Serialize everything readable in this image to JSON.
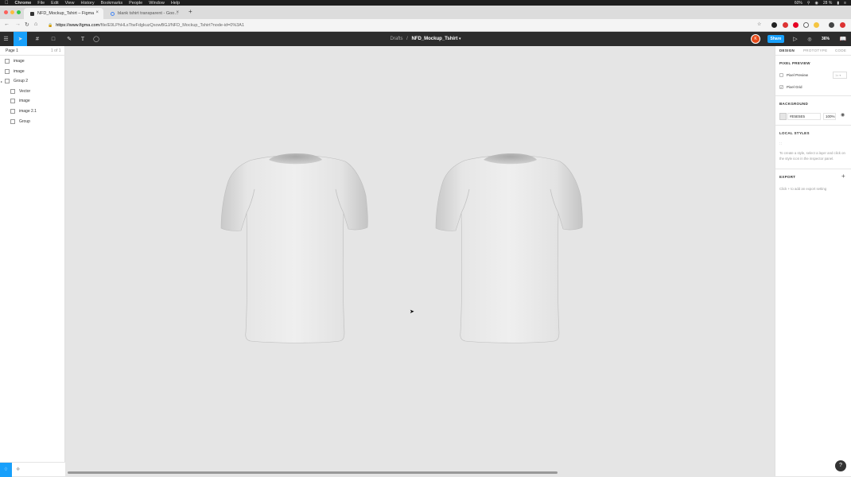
{
  "menubar": {
    "app": "Chrome",
    "items": [
      "File",
      "Edit",
      "View",
      "History",
      "Bookmarks",
      "People",
      "Window",
      "Help"
    ],
    "status": {
      "cpu": "60%",
      "battery": "28 %"
    }
  },
  "browser": {
    "tabs": [
      {
        "title": "NFD_Mockup_Tshirt – Figma",
        "active": true
      },
      {
        "title": "blank tshirt transparent - Goo…",
        "active": false
      }
    ],
    "new_tab": "+",
    "url_host": "https://www.figma.com",
    "url_path": "/file/E9LPhHLsTtwFdgkuzQsowBGJ/NFD_Mockup_Tshirt?node-id=0%3A1"
  },
  "figma": {
    "breadcrumb": "Drafts",
    "separator": "/",
    "file_name": "NFD_Mockup_Tshirt",
    "share_label": "Share",
    "avatar_initial": "K",
    "zoom": "36%"
  },
  "layers": {
    "page_name": "Page 1",
    "page_count": "1 of 1",
    "items": [
      {
        "name": "image",
        "indent": 0,
        "type": "image"
      },
      {
        "name": "image",
        "indent": 0,
        "type": "image"
      },
      {
        "name": "Group 2",
        "indent": 0,
        "type": "group"
      },
      {
        "name": "Vector",
        "indent": 1,
        "type": "vector"
      },
      {
        "name": "image",
        "indent": 1,
        "type": "image"
      },
      {
        "name": "image 2.1",
        "indent": 1,
        "type": "image"
      },
      {
        "name": "Group",
        "indent": 1,
        "type": "group"
      }
    ]
  },
  "inspector": {
    "tabs": [
      "DESIGN",
      "PROTOTYPE",
      "CODE"
    ],
    "pixel_preview": {
      "title": "PIXEL PREVIEW",
      "preview_label": "Pixel Preview",
      "preview_checked": false,
      "scale": "1x",
      "grid_label": "Pixel Grid",
      "grid_checked": true
    },
    "background": {
      "title": "BACKGROUND",
      "hex": "#E5E5E5",
      "opacity": "100%",
      "color": "#E5E5E5"
    },
    "local_styles": {
      "title": "LOCAL STYLES",
      "hint": "To create a style, select a layer and click on the style icon in the inspector panel."
    },
    "export": {
      "title": "EXPORT",
      "add": "+",
      "hint": "Click + to add an export setting"
    }
  },
  "help_label": "?"
}
